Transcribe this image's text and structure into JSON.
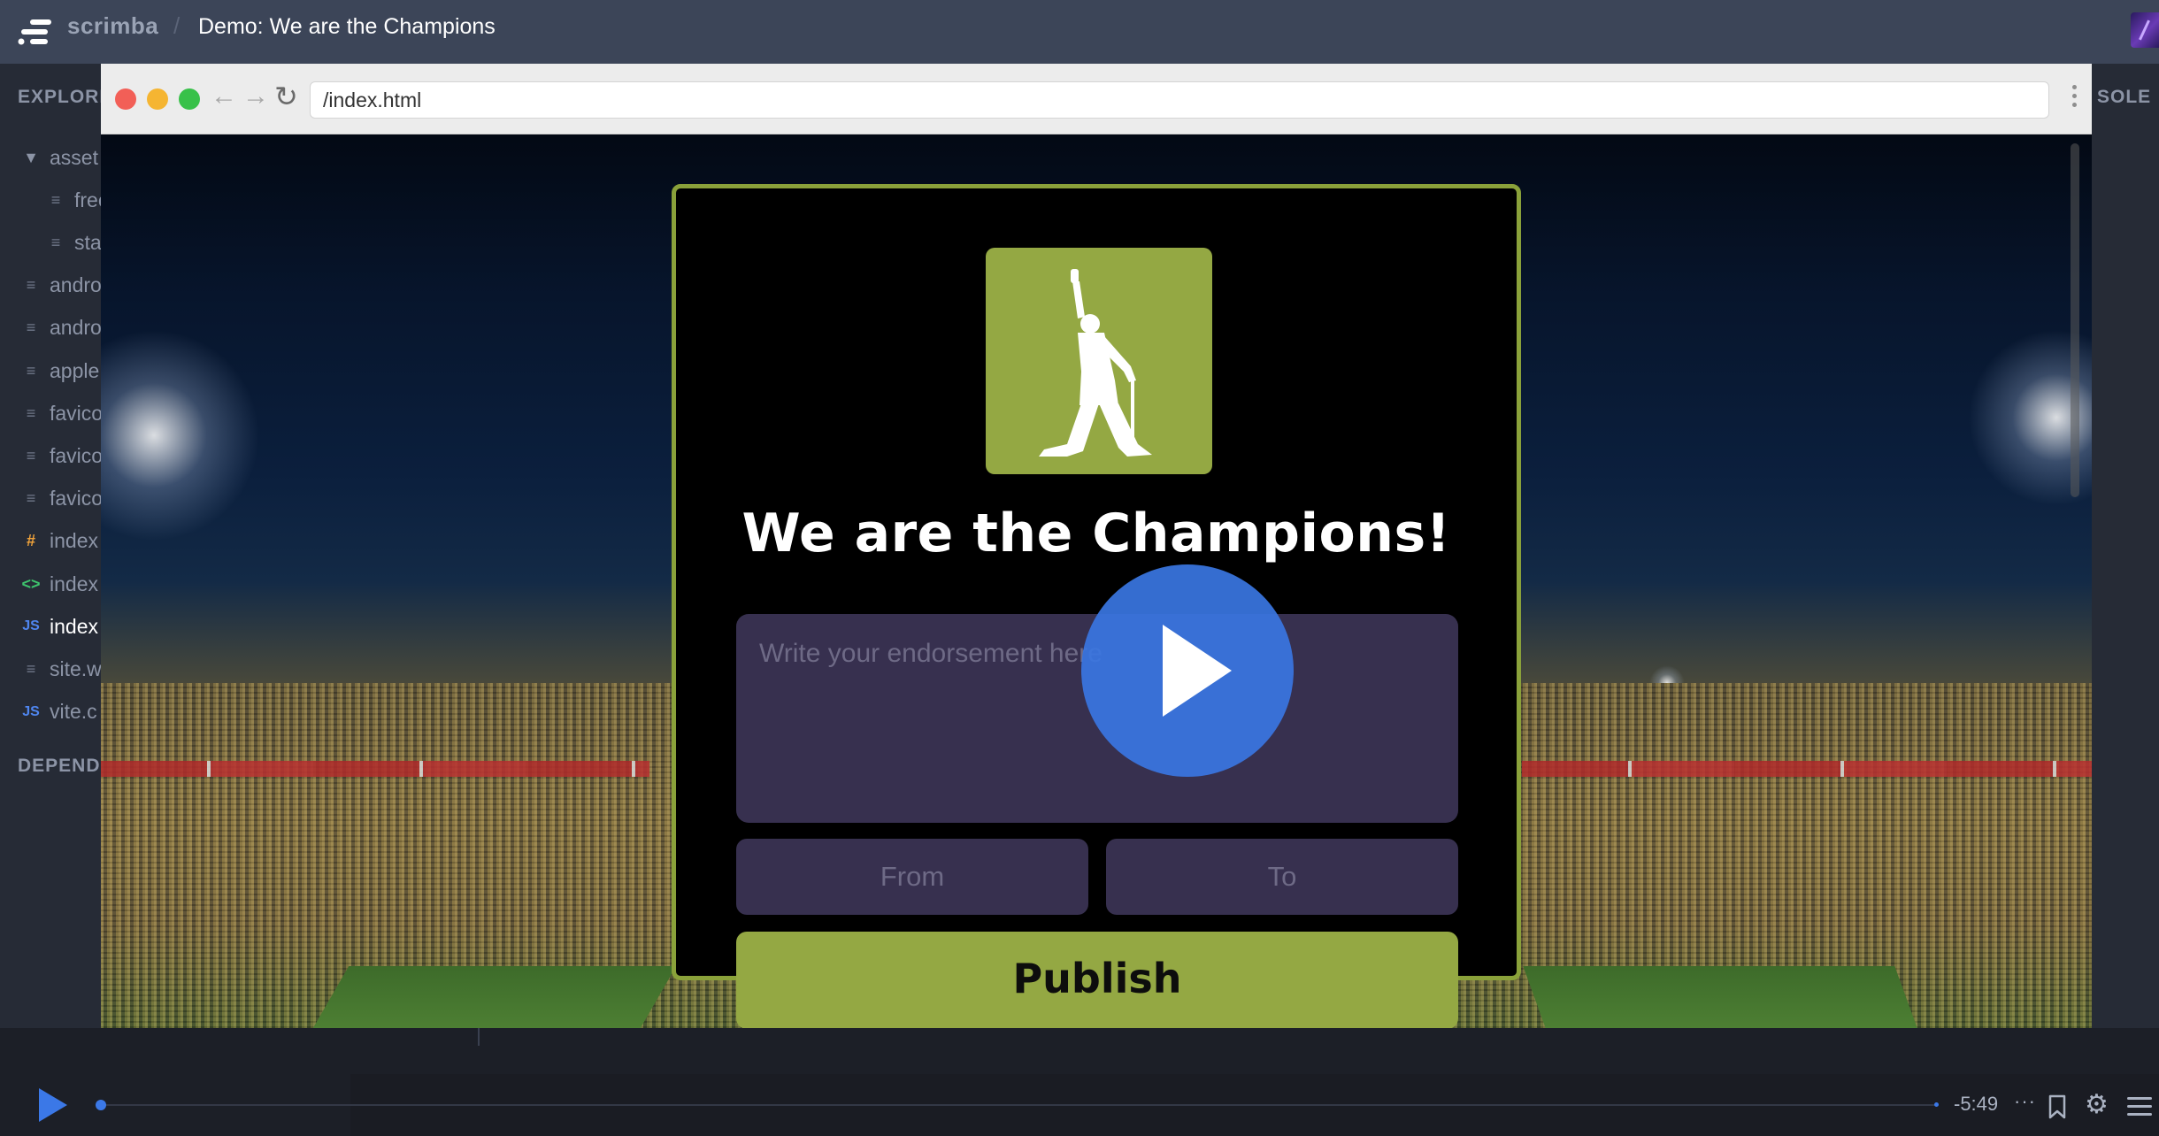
{
  "topbar": {
    "brand": "scrimba",
    "separator": "/",
    "title": "Demo: We are the Champions"
  },
  "sidebar": {
    "explorer_title": "EXPLORE",
    "dependencies_title": "DEPEND",
    "items": [
      {
        "label": "asset",
        "icon": "folder-caret-icon",
        "indent": 0,
        "active": false
      },
      {
        "label": "free",
        "icon": "file-icon",
        "indent": 1,
        "active": false
      },
      {
        "label": "sta",
        "icon": "file-icon",
        "indent": 1,
        "active": false
      },
      {
        "label": "andro",
        "icon": "file-icon",
        "indent": 0,
        "active": false
      },
      {
        "label": "andro",
        "icon": "file-icon",
        "indent": 0,
        "active": false
      },
      {
        "label": "apple",
        "icon": "file-icon",
        "indent": 0,
        "active": false
      },
      {
        "label": "favico",
        "icon": "file-icon",
        "indent": 0,
        "active": false
      },
      {
        "label": "favico",
        "icon": "file-icon",
        "indent": 0,
        "active": false
      },
      {
        "label": "favico",
        "icon": "file-icon",
        "indent": 0,
        "active": false
      },
      {
        "label": "index",
        "icon": "css-hash-icon",
        "indent": 0,
        "active": false
      },
      {
        "label": "index",
        "icon": "html-code-icon",
        "indent": 0,
        "active": false
      },
      {
        "label": "index",
        "icon": "js-icon",
        "indent": 0,
        "active": true
      },
      {
        "label": "site.w",
        "icon": "file-icon",
        "indent": 0,
        "active": false
      },
      {
        "label": "vite.c",
        "icon": "js-icon",
        "indent": 0,
        "active": false
      }
    ]
  },
  "right_panel": {
    "title": "SOLE"
  },
  "browser": {
    "url": "/index.html"
  },
  "app": {
    "heading": "We are the Champions!",
    "endorsement_placeholder": "Write your endorsement here",
    "from_placeholder": "From",
    "to_placeholder": "To",
    "publish_label": "Publish"
  },
  "player": {
    "time_remaining": "-5:49",
    "progress": 0.0,
    "more_label": "···"
  },
  "colors": {
    "accent_green": "#94a843",
    "input_bg": "#37304f",
    "scrimba_blue": "#3b78e7",
    "topbar_bg": "#3c4558"
  }
}
